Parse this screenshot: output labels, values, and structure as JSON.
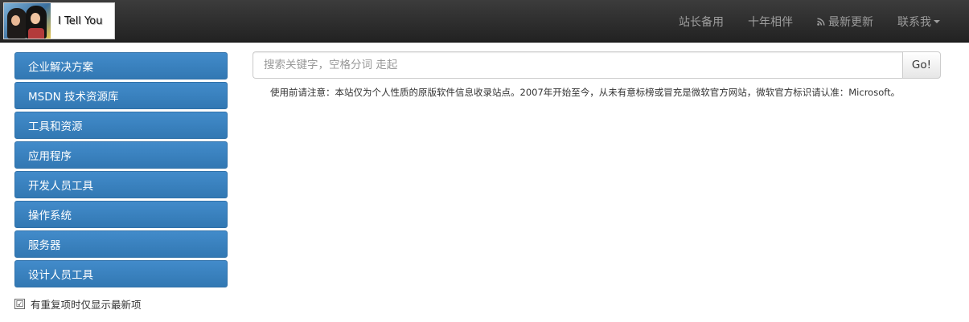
{
  "brand": {
    "title": "I Tell You"
  },
  "nav": {
    "links": [
      {
        "label": "站长备用"
      },
      {
        "label": "十年相伴"
      },
      {
        "label": "最新更新",
        "icon": "rss-icon"
      },
      {
        "label": "联系我",
        "icon": "caret-down-icon"
      }
    ]
  },
  "sidebar": {
    "items": [
      {
        "label": "企业解决方案"
      },
      {
        "label": "MSDN 技术资源库"
      },
      {
        "label": "工具和资源"
      },
      {
        "label": "应用程序"
      },
      {
        "label": "开发人员工具"
      },
      {
        "label": "操作系统"
      },
      {
        "label": "服务器"
      },
      {
        "label": "设计人员工具"
      }
    ],
    "checkbox": {
      "label": "有重复项时仅显示最新项",
      "checked": true,
      "mark": "☑"
    }
  },
  "search": {
    "placeholder": "搜索关键字，空格分词 走起",
    "value": "",
    "button_label": "Go!"
  },
  "notice": {
    "text": "使用前请注意：本站仅为个人性质的原版软件信息收录站点。2007年开始至今，从未有意标榜或冒充是微软官方网站，微软官方标识请认准：Microsoft。"
  },
  "colors": {
    "navbar": "#222222",
    "nav_text": "#9d9d9d",
    "menu_button": "#428bca",
    "menu_text": "#ffffff"
  }
}
